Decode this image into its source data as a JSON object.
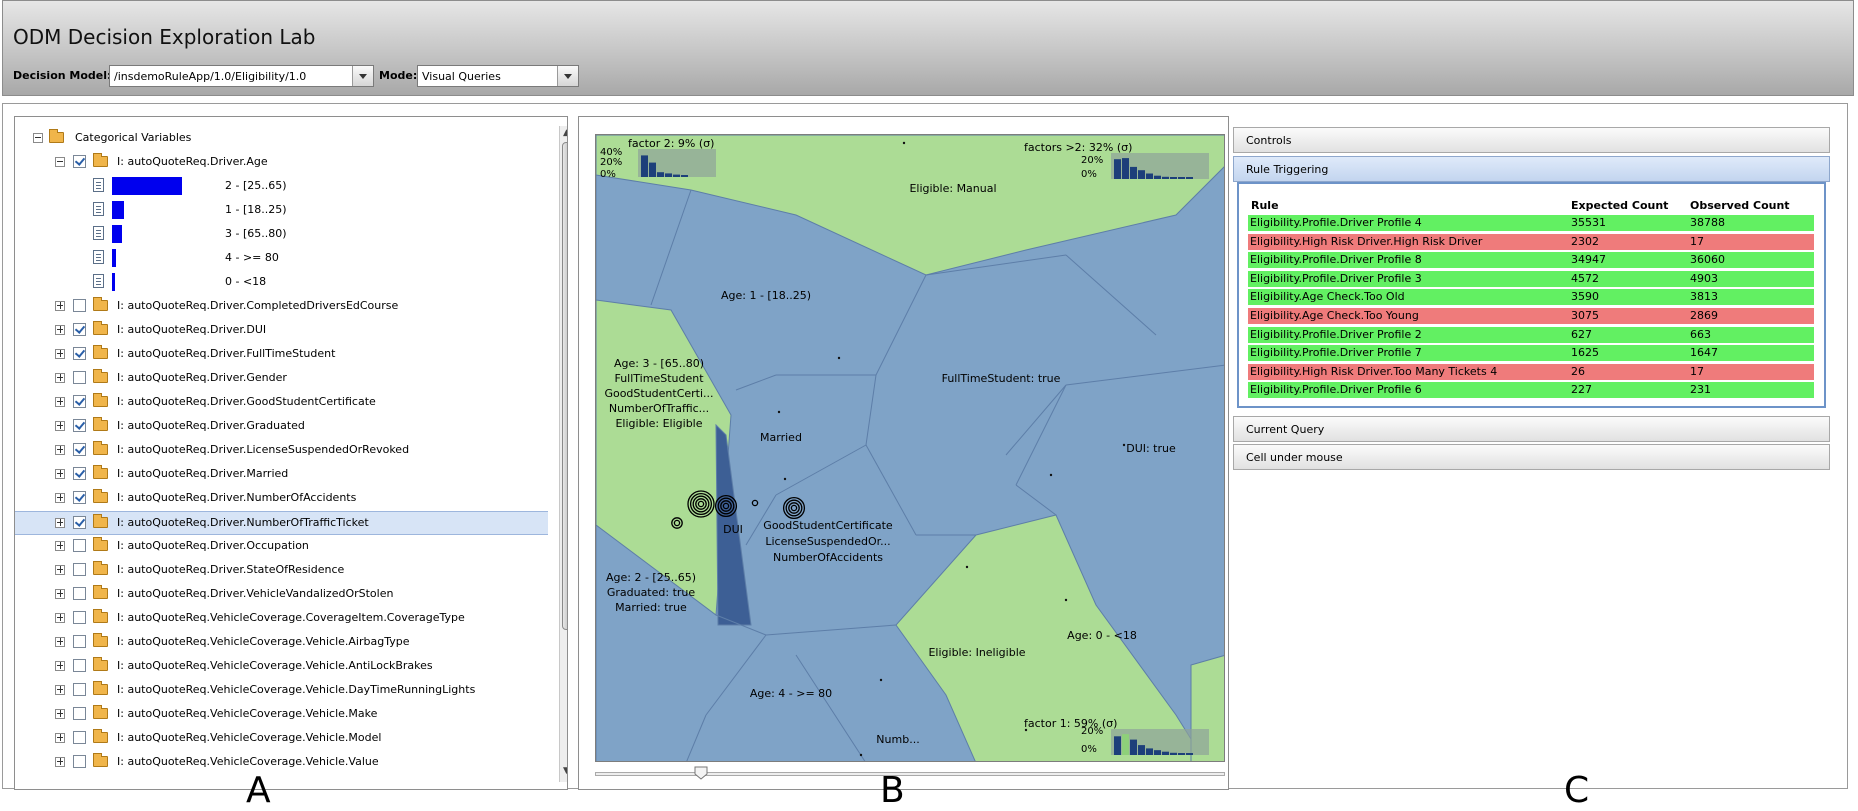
{
  "header": {
    "title": "ODM Decision Exploration Lab",
    "decision_model_label": "Decision Model:",
    "decision_model_value": "/insdemoRuleApp/1.0/Eligibility/1.0",
    "mode_label": "Mode:",
    "mode_value": "Visual Queries"
  },
  "tree": {
    "root_label": "Categorical Variables",
    "age_node": "I: autoQuoteReq.Driver.Age",
    "age_bins": [
      {
        "label": "2 - [25..65)",
        "fraction": 1.0
      },
      {
        "label": "1 - [18..25)",
        "fraction": 0.17
      },
      {
        "label": "3 - [65..80)",
        "fraction": 0.14
      },
      {
        "label": "4 - >= 80",
        "fraction": 0.05
      },
      {
        "label": "0 - <18",
        "fraction": 0.04
      }
    ],
    "items": [
      {
        "label": "I: autoQuoteReq.Driver.CompletedDriversEdCourse",
        "checked": false,
        "selected": false
      },
      {
        "label": "I: autoQuoteReq.Driver.DUI",
        "checked": true,
        "selected": false
      },
      {
        "label": "I: autoQuoteReq.Driver.FullTimeStudent",
        "checked": true,
        "selected": false
      },
      {
        "label": "I: autoQuoteReq.Driver.Gender",
        "checked": false,
        "selected": false
      },
      {
        "label": "I: autoQuoteReq.Driver.GoodStudentCertificate",
        "checked": true,
        "selected": false
      },
      {
        "label": "I: autoQuoteReq.Driver.Graduated",
        "checked": true,
        "selected": false
      },
      {
        "label": "I: autoQuoteReq.Driver.LicenseSuspendedOrRevoked",
        "checked": true,
        "selected": false
      },
      {
        "label": "I: autoQuoteReq.Driver.Married",
        "checked": true,
        "selected": false
      },
      {
        "label": "I: autoQuoteReq.Driver.NumberOfAccidents",
        "checked": true,
        "selected": false
      },
      {
        "label": "I: autoQuoteReq.Driver.NumberOfTrafficTicket",
        "checked": true,
        "selected": true
      },
      {
        "label": "I: autoQuoteReq.Driver.Occupation",
        "checked": false,
        "selected": false
      },
      {
        "label": "I: autoQuoteReq.Driver.StateOfResidence",
        "checked": false,
        "selected": false
      },
      {
        "label": "I: autoQuoteReq.Driver.VehicleVandalizedOrStolen",
        "checked": false,
        "selected": false
      },
      {
        "label": "I: autoQuoteReq.VehicleCoverage.CoverageItem.CoverageType",
        "checked": false,
        "selected": false
      },
      {
        "label": "I: autoQuoteReq.VehicleCoverage.Vehicle.AirbagType",
        "checked": false,
        "selected": false
      },
      {
        "label": "I: autoQuoteReq.VehicleCoverage.Vehicle.AntiLockBrakes",
        "checked": false,
        "selected": false
      },
      {
        "label": "I: autoQuoteReq.VehicleCoverage.Vehicle.DayTimeRunningLights",
        "checked": false,
        "selected": false
      },
      {
        "label": "I: autoQuoteReq.VehicleCoverage.Vehicle.Make",
        "checked": false,
        "selected": false
      },
      {
        "label": "I: autoQuoteReq.VehicleCoverage.Vehicle.Model",
        "checked": false,
        "selected": false
      },
      {
        "label": "I: autoQuoteReq.VehicleCoverage.Vehicle.Value",
        "checked": false,
        "selected": false
      }
    ]
  },
  "map": {
    "colors": {
      "blue": "#7fa3c7",
      "green": "#acdc95",
      "dark": "#3d5f95",
      "edge": "#5d7ea8"
    },
    "factor2": {
      "title": "factor 2: 9% (σ)",
      "ticks": [
        "40%",
        "20%",
        "0%"
      ],
      "bars": [
        0.9,
        0.6,
        0.2,
        0.15,
        0.1,
        0.05
      ]
    },
    "factors_gt2": {
      "title": "factors >2: 32% (σ)",
      "ticks": [
        "20%",
        "0%"
      ],
      "bars": [
        0.9,
        0.95,
        0.55,
        0.4,
        0.25,
        0.15,
        0.1,
        0.08,
        0.06,
        0.05
      ]
    },
    "factor1": {
      "title": "factor 1: 59% (σ)",
      "ticks": [
        "20%",
        "0%"
      ],
      "bars": [
        0.85,
        0.95,
        0.7,
        0.45,
        0.3,
        0.22,
        0.15,
        0.1,
        0.08,
        0.06
      ]
    },
    "labels": {
      "eligible_manual": "Eligible: Manual",
      "age1": "Age: 1 - [18..25)",
      "fulltime": "FullTimeStudent: true",
      "age3_lines": [
        "Age: 3 - [65..80)",
        "FullTimeStudent",
        "GoodStudentCerti...",
        "NumberOfTraffic...",
        "Eligible: Eligible"
      ],
      "married": "Married",
      "dui_true": "DUI: true",
      "dui": "DUI",
      "good_lines": [
        "GoodStudentCertificate",
        "LicenseSuspendedOr...",
        "NumberOfAccidents"
      ],
      "age2_lines": [
        "Age: 2 - [25..65)",
        "Graduated: true",
        "Married: true"
      ],
      "age0": "Age: 0 - <18",
      "ineligible": "Eligible: Ineligible",
      "age4": "Age: 4 - >= 80",
      "numb": "Numb..."
    }
  },
  "panelC": {
    "controls": "Controls",
    "rule_triggering": "Rule Triggering",
    "current_query": "Current Query",
    "cell_under_mouse": "Cell under mouse",
    "columns": [
      "Rule",
      "Expected Count",
      "Observed Count"
    ],
    "colors": {
      "ok": "#62f062",
      "bad": "#ef7b7b"
    },
    "rules": [
      {
        "rule": "Eligibility.Profile.Driver Profile 4",
        "expected": "35531",
        "observed": "38788",
        "status": "ok"
      },
      {
        "rule": "Eligibility.High Risk Driver.High Risk Driver",
        "expected": "2302",
        "observed": "17",
        "status": "bad"
      },
      {
        "rule": "Eligibility.Profile.Driver Profile 8",
        "expected": "34947",
        "observed": "36060",
        "status": "ok"
      },
      {
        "rule": "Eligibility.Profile.Driver Profile 3",
        "expected": "4572",
        "observed": "4903",
        "status": "ok"
      },
      {
        "rule": "Eligibility.Age Check.Too Old",
        "expected": "3590",
        "observed": "3813",
        "status": "ok"
      },
      {
        "rule": "Eligibility.Age Check.Too Young",
        "expected": "3075",
        "observed": "2869",
        "status": "bad"
      },
      {
        "rule": "Eligibility.Profile.Driver Profile 2",
        "expected": "627",
        "observed": "663",
        "status": "ok"
      },
      {
        "rule": "Eligibility.Profile.Driver Profile 7",
        "expected": "1625",
        "observed": "1647",
        "status": "ok"
      },
      {
        "rule": "Eligibility.High Risk Driver.Too Many Tickets 4",
        "expected": "26",
        "observed": "17",
        "status": "bad"
      },
      {
        "rule": "Eligibility.Profile.Driver Profile 6",
        "expected": "227",
        "observed": "231",
        "status": "ok"
      }
    ]
  },
  "panel_letters": {
    "a": "A",
    "b": "B",
    "c": "C"
  }
}
